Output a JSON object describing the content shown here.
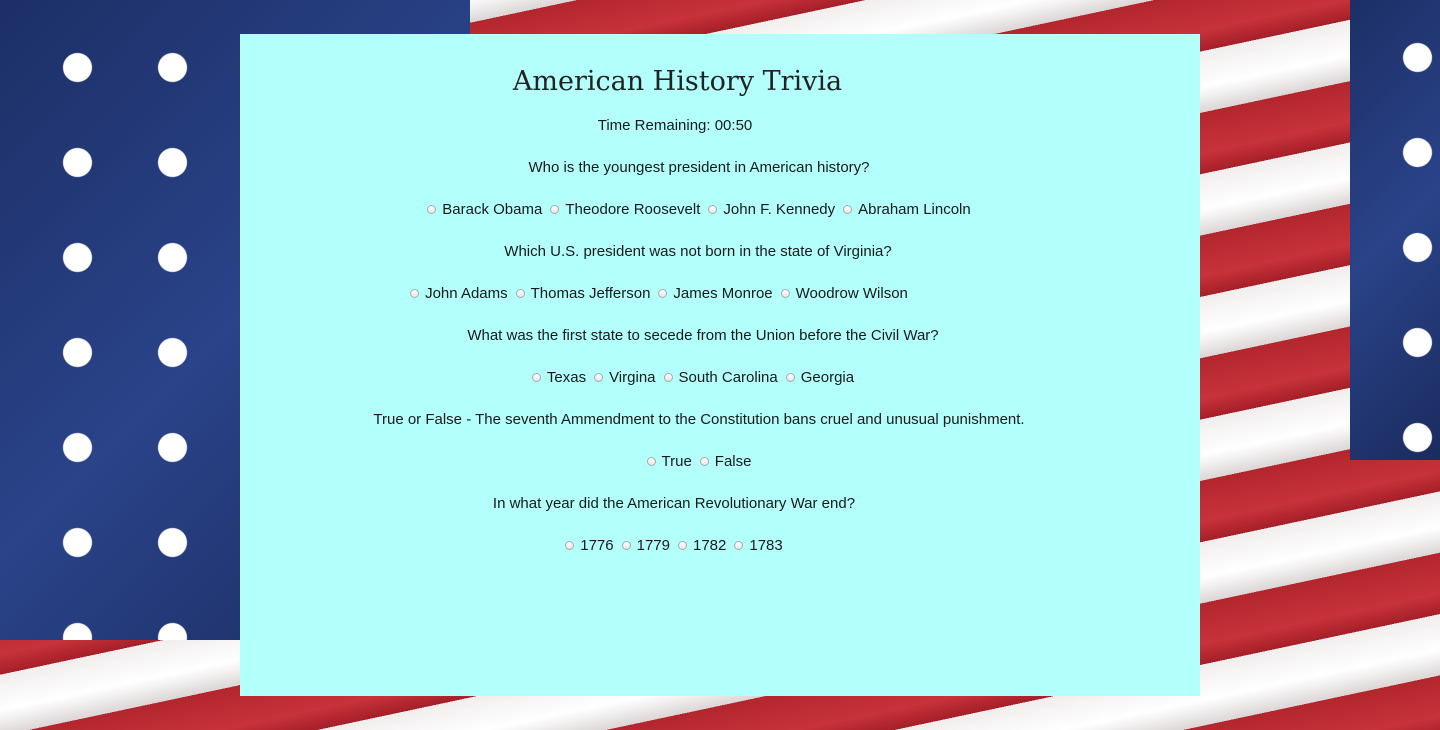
{
  "page": {
    "title": "American History Trivia",
    "timer_label": "Time Remaining: 00:50"
  },
  "colors": {
    "panel_background": "#b2fffb",
    "flag_blue": "#233a78",
    "flag_red": "#b3262e"
  },
  "questions": [
    {
      "text": "Who is the youngest president in American history?",
      "options": [
        "Barack Obama",
        "Theodore Roosevelt",
        "John F. Kennedy",
        "Abraham Lincoln"
      ]
    },
    {
      "text": "Which U.S. president was not born in the state of Virginia?",
      "options": [
        "John Adams",
        "Thomas Jefferson",
        "James Monroe",
        "Woodrow Wilson"
      ]
    },
    {
      "text": "What was the first state to secede from the Union before the Civil War?",
      "options": [
        "Texas",
        "Virgina",
        "South Carolina",
        "Georgia"
      ]
    },
    {
      "text": "True or False - The seventh Ammendment to the Constitution bans cruel and unusual punishment.",
      "options": [
        "True",
        "False"
      ]
    },
    {
      "text": "In what year did the American Revolutionary War end?",
      "options": [
        "1776",
        "1779",
        "1782",
        "1783"
      ]
    }
  ]
}
